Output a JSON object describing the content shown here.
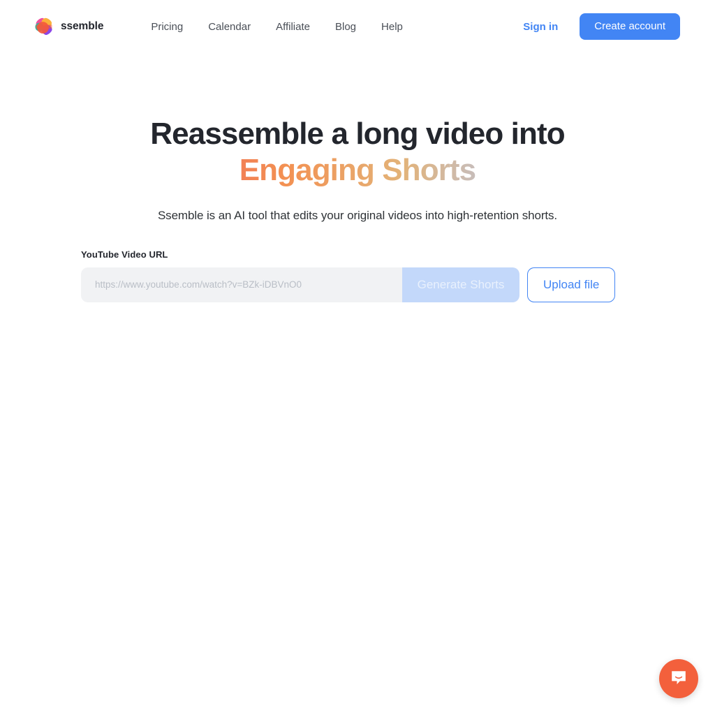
{
  "header": {
    "brand": {
      "name": "ssemble",
      "logo_icon": "ssemble-logo-icon"
    },
    "nav": [
      {
        "label": "Pricing"
      },
      {
        "label": "Calendar"
      },
      {
        "label": "Affiliate"
      },
      {
        "label": "Blog"
      },
      {
        "label": "Help"
      }
    ],
    "sign_in_label": "Sign in",
    "create_account_label": "Create account"
  },
  "hero": {
    "headline_line1": "Reassemble a long video into",
    "headline_line2": "Engaging Shorts",
    "subtitle": "Ssemble is an AI tool that edits your original videos into high-retention shorts."
  },
  "form": {
    "field_label": "YouTube Video URL",
    "url_value": "",
    "url_placeholder": "https://www.youtube.com/watch?v=BZk-iDBVnO0",
    "generate_label": "Generate Shorts",
    "upload_label": "Upload file"
  },
  "chat": {
    "icon": "chat-smile-bubble-icon"
  },
  "colors": {
    "accent_blue": "#4285f4",
    "text_dark": "#23262d",
    "input_bg": "#f1f2f4",
    "generate_disabled_bg": "#c3d8fa",
    "chat_orange": "#f3603c",
    "gradient_pink": "#e8417c",
    "gradient_orange": "#f39152",
    "gradient_tan": "#e3b277",
    "gradient_blue": "#5b8fe2"
  }
}
